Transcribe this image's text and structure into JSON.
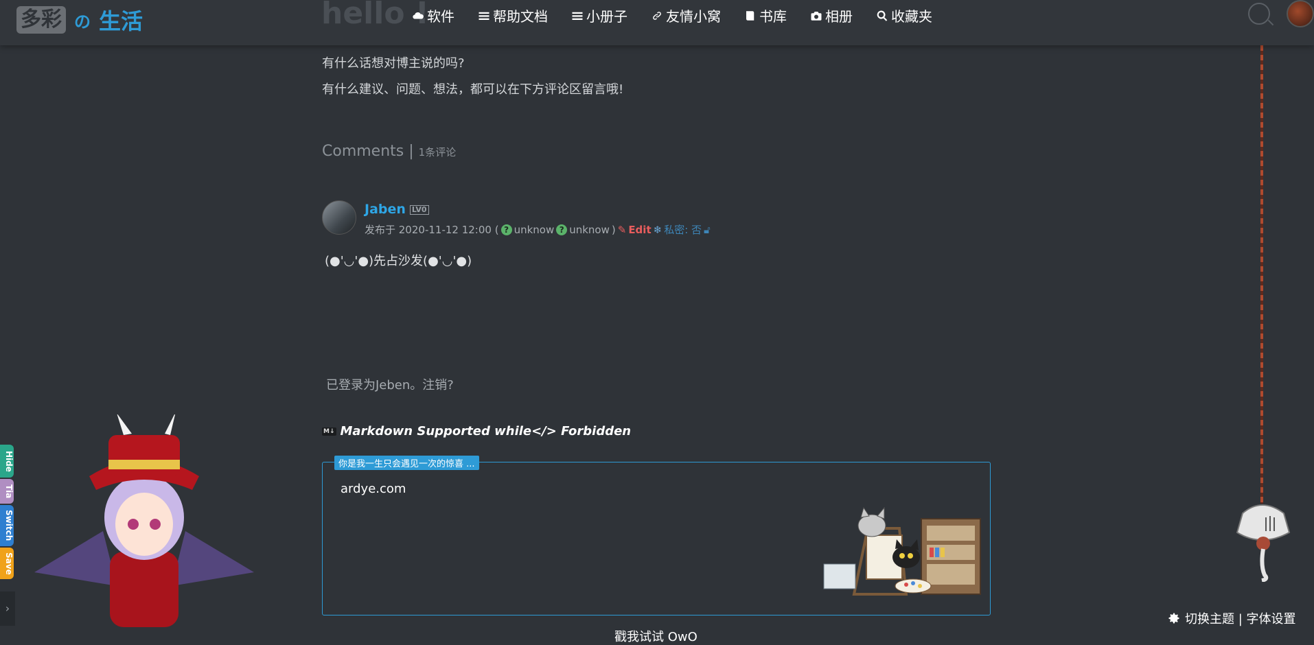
{
  "header": {
    "logo_box": "多彩",
    "logo_no": "の",
    "logo_life": "生活",
    "hello": "hello !",
    "nav": [
      {
        "label": "软件",
        "icon": "cloud-icon"
      },
      {
        "label": "帮助文档",
        "icon": "list-icon"
      },
      {
        "label": "小册子",
        "icon": "list-icon"
      },
      {
        "label": "友情小窝",
        "icon": "link-icon"
      },
      {
        "label": "书库",
        "icon": "book-icon"
      },
      {
        "label": "相册",
        "icon": "camera-icon"
      },
      {
        "label": "收藏夹",
        "icon": "search-icon"
      }
    ]
  },
  "intro": {
    "line1": "有什么话想对博主说的吗?",
    "line2": "有什么建议、问题、想法，都可以在下方评论区留言哦!"
  },
  "comments": {
    "title": "Comments | ",
    "count": "1条评论",
    "items": [
      {
        "author": "Jaben",
        "level": "LV0",
        "meta_prefix": "发布于 2020-11-12 12:00 (",
        "os": "unknow",
        "browser": "unknow",
        "meta_close": ")",
        "edit": "Edit",
        "private_label": "私密: 否",
        "content": "(●'◡'●)先占沙发(●'◡'●)"
      }
    ]
  },
  "logged_in": "已登录为Jeben。注销?",
  "markdown_note": "Markdown Supported while</> Forbidden",
  "md_icon": "M↓",
  "textarea": {
    "label": "你是我一生只会遇见一次的惊喜 ...",
    "value": "ardye.com"
  },
  "below_text": "戳我试试 OwO",
  "theme_settings": "切换主题 | 字体设置",
  "side_tabs": [
    {
      "label": "Hide",
      "color": "#2aa68a"
    },
    {
      "label": "Tia",
      "color": "#b08ec2"
    },
    {
      "label": "Switch",
      "color": "#2e7fd0"
    },
    {
      "label": "Save",
      "color": "#f0a21a"
    }
  ],
  "colors": {
    "accent": "#2e9bd6",
    "background": "#2f3338",
    "edit": "#e85d5d"
  }
}
